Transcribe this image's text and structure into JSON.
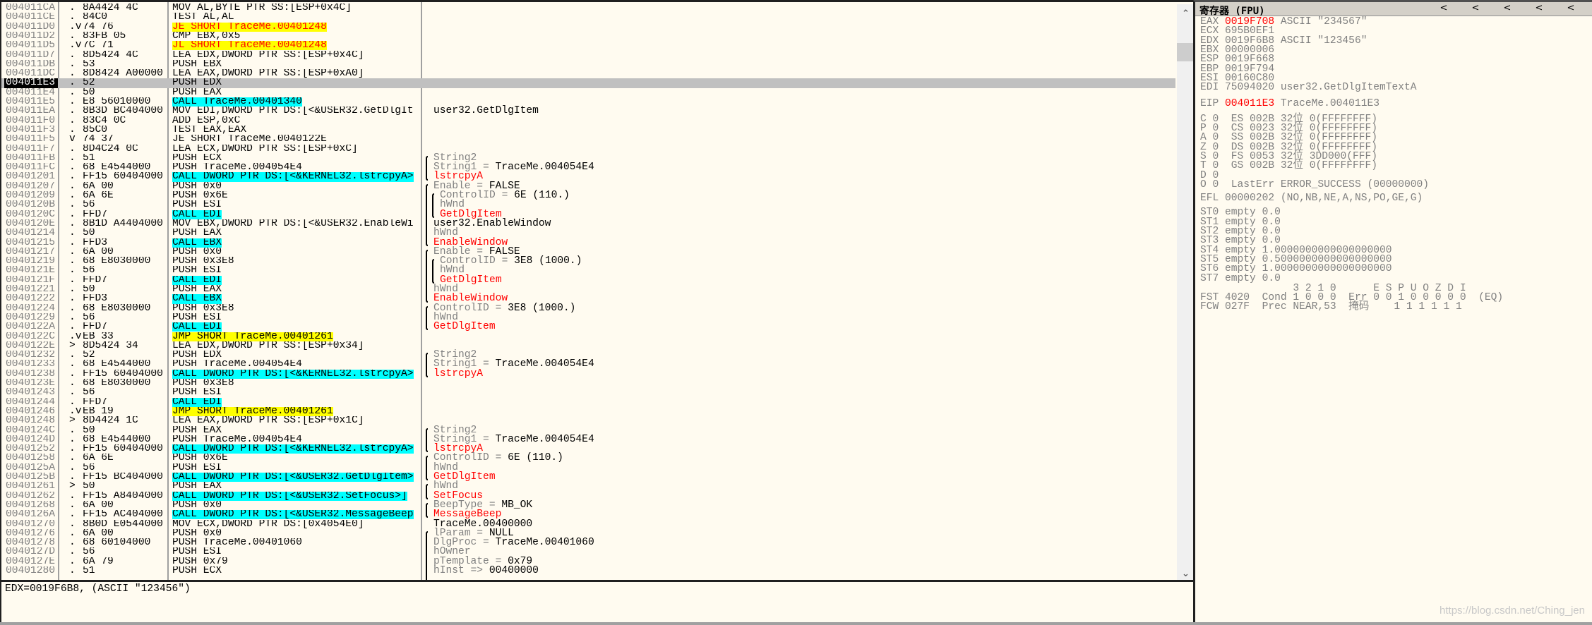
{
  "colors": {
    "background": "#fffbf0",
    "call_highlight": "#00ffff",
    "jump_highlight": "#ffff00",
    "jcc_text": "#ff0000",
    "selected_row": "#c0c0c0",
    "changed_register": "#ff0000"
  },
  "disasm": {
    "selected_index": 8,
    "rows": [
      {
        "addr": "004011CA",
        "mark": ".",
        "hex": "8A4424 4C",
        "asm": "MOV AL,BYTE PTR SS:[ESP+0x4C]",
        "hl": "",
        "cm": []
      },
      {
        "addr": "004011CE",
        "mark": ".",
        "hex": "84C0",
        "asm": "TEST AL,AL",
        "hl": "",
        "cm": []
      },
      {
        "addr": "004011D0",
        "mark": ".v",
        "hex": "74 76",
        "asm": "JE SHORT TraceMe.00401248",
        "hl": "jcc",
        "cm": []
      },
      {
        "addr": "004011D2",
        "mark": ".",
        "hex": "83FB 05",
        "asm": "CMP EBX,0x5",
        "hl": "",
        "cm": []
      },
      {
        "addr": "004011D5",
        "mark": ".v",
        "hex": "7C 71",
        "asm": "JL SHORT TraceMe.00401248",
        "hl": "jcc",
        "cm": []
      },
      {
        "addr": "004011D7",
        "mark": ".",
        "hex": "8D5424 4C",
        "asm": "LEA EDX,DWORD PTR SS:[ESP+0x4C]",
        "hl": "",
        "cm": []
      },
      {
        "addr": "004011DB",
        "mark": ".",
        "hex": "53",
        "asm": "PUSH EBX",
        "hl": "",
        "cm": []
      },
      {
        "addr": "004011DC",
        "mark": ".",
        "hex": "8D8424 A00000",
        "asm": "LEA EAX,DWORD PTR SS:[ESP+0xA0]",
        "hl": "",
        "cm": []
      },
      {
        "addr": "004011E3",
        "mark": ".",
        "hex": "52",
        "asm": "PUSH EDX",
        "hl": "",
        "cm": []
      },
      {
        "addr": "004011E4",
        "mark": ".",
        "hex": "50",
        "asm": "PUSH EAX",
        "hl": "",
        "cm": []
      },
      {
        "addr": "004011E5",
        "mark": ".",
        "hex": "E8 56010000",
        "asm": "CALL TraceMe.00401340",
        "hl": "call",
        "cm": []
      },
      {
        "addr": "004011EA",
        "mark": ".",
        "hex": "8B3D BC404000",
        "asm": "MOV EDI,DWORD PTR DS:[<&USER32.GetDlgIt",
        "hl": "",
        "cm": [
          [
            "user32.GetDlgItem",
            "k"
          ]
        ]
      },
      {
        "addr": "004011F0",
        "mark": ".",
        "hex": "83C4 0C",
        "asm": "ADD ESP,0xC",
        "hl": "",
        "cm": []
      },
      {
        "addr": "004011F3",
        "mark": ".",
        "hex": "85C0",
        "asm": "TEST EAX,EAX",
        "hl": "",
        "cm": []
      },
      {
        "addr": "004011F5",
        "mark": "v",
        "hex": "74 37",
        "asm": "JE SHORT TraceMe.0040122E",
        "hl": "",
        "cm": []
      },
      {
        "addr": "004011F7",
        "mark": ".",
        "hex": "8D4C24 0C",
        "asm": "LEA ECX,DWORD PTR SS:[ESP+0xC]",
        "hl": "",
        "cm": []
      },
      {
        "addr": "004011FB",
        "mark": ".",
        "hex": "51",
        "asm": "PUSH ECX",
        "hl": "",
        "cm": [
          [
            "String2",
            "g"
          ]
        ]
      },
      {
        "addr": "004011FC",
        "mark": ".",
        "hex": "68 E4544000",
        "asm": "PUSH TraceMe.004054E4",
        "hl": "",
        "cm": [
          [
            "String1 = ",
            "g"
          ],
          [
            "TraceMe.004054E4",
            "k"
          ]
        ]
      },
      {
        "addr": "00401201",
        "mark": ".",
        "hex": "FF15 60404000",
        "asm": "CALL DWORD PTR DS:[<&KERNEL32.lstrcpyA>",
        "hl": "call",
        "cm": [
          [
            "lstrcpyA",
            "r"
          ]
        ]
      },
      {
        "addr": "00401207",
        "mark": ".",
        "hex": "6A 00",
        "asm": "PUSH 0x0",
        "hl": "",
        "cm": [
          [
            "Enable = ",
            "g"
          ],
          [
            "FALSE",
            "k"
          ]
        ]
      },
      {
        "addr": "00401209",
        "mark": ".",
        "hex": "6A 6E",
        "asm": "PUSH 0x6E",
        "hl": "",
        "cm": [
          [
            "ControlID = ",
            "g"
          ],
          [
            "6E (110.)",
            "k"
          ]
        ]
      },
      {
        "addr": "0040120B",
        "mark": ".",
        "hex": "56",
        "asm": "PUSH ESI",
        "hl": "",
        "cm": [
          [
            "hWnd",
            "g"
          ]
        ]
      },
      {
        "addr": "0040120C",
        "mark": ".",
        "hex": "FFD7",
        "asm": "CALL EDI",
        "hl": "call",
        "cm": [
          [
            "GetDlgItem",
            "r"
          ]
        ]
      },
      {
        "addr": "0040120E",
        "mark": ".",
        "hex": "8B1D A4404000",
        "asm": "MOV EBX,DWORD PTR DS:[<&USER32.EnableWi",
        "hl": "",
        "cm": [
          [
            "user32.EnableWindow",
            "k"
          ]
        ]
      },
      {
        "addr": "00401214",
        "mark": ".",
        "hex": "50",
        "asm": "PUSH EAX",
        "hl": "",
        "cm": [
          [
            "hWnd",
            "g"
          ]
        ]
      },
      {
        "addr": "00401215",
        "mark": ".",
        "hex": "FFD3",
        "asm": "CALL EBX",
        "hl": "call",
        "cm": [
          [
            "EnableWindow",
            "r"
          ]
        ]
      },
      {
        "addr": "00401217",
        "mark": ".",
        "hex": "6A 00",
        "asm": "PUSH 0x0",
        "hl": "",
        "cm": [
          [
            "Enable = ",
            "g"
          ],
          [
            "FALSE",
            "k"
          ]
        ]
      },
      {
        "addr": "00401219",
        "mark": ".",
        "hex": "68 E8030000",
        "asm": "PUSH 0x3E8",
        "hl": "",
        "cm": [
          [
            "ControlID = ",
            "g"
          ],
          [
            "3E8 (1000.)",
            "k"
          ]
        ]
      },
      {
        "addr": "0040121E",
        "mark": ".",
        "hex": "56",
        "asm": "PUSH ESI",
        "hl": "",
        "cm": [
          [
            "hWnd",
            "g"
          ]
        ]
      },
      {
        "addr": "0040121F",
        "mark": ".",
        "hex": "FFD7",
        "asm": "CALL EDI",
        "hl": "call",
        "cm": [
          [
            "GetDlgItem",
            "r"
          ]
        ]
      },
      {
        "addr": "00401221",
        "mark": ".",
        "hex": "50",
        "asm": "PUSH EAX",
        "hl": "",
        "cm": [
          [
            "hWnd",
            "g"
          ]
        ]
      },
      {
        "addr": "00401222",
        "mark": ".",
        "hex": "FFD3",
        "asm": "CALL EBX",
        "hl": "call",
        "cm": [
          [
            "EnableWindow",
            "r"
          ]
        ]
      },
      {
        "addr": "00401224",
        "mark": ".",
        "hex": "68 E8030000",
        "asm": "PUSH 0x3E8",
        "hl": "",
        "cm": [
          [
            "ControlID = ",
            "g"
          ],
          [
            "3E8 (1000.)",
            "k"
          ]
        ]
      },
      {
        "addr": "00401229",
        "mark": ".",
        "hex": "56",
        "asm": "PUSH ESI",
        "hl": "",
        "cm": [
          [
            "hWnd",
            "g"
          ]
        ]
      },
      {
        "addr": "0040122A",
        "mark": ".",
        "hex": "FFD7",
        "asm": "CALL EDI",
        "hl": "call",
        "cm": [
          [
            "GetDlgItem",
            "r"
          ]
        ]
      },
      {
        "addr": "0040122C",
        "mark": ".v",
        "hex": "EB 33",
        "asm": "JMP SHORT TraceMe.00401261",
        "hl": "jmp",
        "cm": []
      },
      {
        "addr": "0040122E",
        "mark": ">",
        "hex": "8D5424 34",
        "asm": "LEA EDX,DWORD PTR SS:[ESP+0x34]",
        "hl": "",
        "cm": []
      },
      {
        "addr": "00401232",
        "mark": ".",
        "hex": "52",
        "asm": "PUSH EDX",
        "hl": "",
        "cm": [
          [
            "String2",
            "g"
          ]
        ]
      },
      {
        "addr": "00401233",
        "mark": ".",
        "hex": "68 E4544000",
        "asm": "PUSH TraceMe.004054E4",
        "hl": "",
        "cm": [
          [
            "String1 = ",
            "g"
          ],
          [
            "TraceMe.004054E4",
            "k"
          ]
        ]
      },
      {
        "addr": "00401238",
        "mark": ".",
        "hex": "FF15 60404000",
        "asm": "CALL DWORD PTR DS:[<&KERNEL32.lstrcpyA>",
        "hl": "call",
        "cm": [
          [
            "lstrcpyA",
            "r"
          ]
        ]
      },
      {
        "addr": "0040123E",
        "mark": ".",
        "hex": "68 E8030000",
        "asm": "PUSH 0x3E8",
        "hl": "",
        "cm": []
      },
      {
        "addr": "00401243",
        "mark": ".",
        "hex": "56",
        "asm": "PUSH ESI",
        "hl": "",
        "cm": []
      },
      {
        "addr": "00401244",
        "mark": ".",
        "hex": "FFD7",
        "asm": "CALL EDI",
        "hl": "call",
        "cm": []
      },
      {
        "addr": "00401246",
        "mark": ".v",
        "hex": "EB 19",
        "asm": "JMP SHORT TraceMe.00401261",
        "hl": "jmp",
        "cm": []
      },
      {
        "addr": "00401248",
        "mark": ">",
        "hex": "8D4424 1C",
        "asm": "LEA EAX,DWORD PTR SS:[ESP+0x1C]",
        "hl": "",
        "cm": []
      },
      {
        "addr": "0040124C",
        "mark": ".",
        "hex": "50",
        "asm": "PUSH EAX",
        "hl": "",
        "cm": [
          [
            "String2",
            "g"
          ]
        ]
      },
      {
        "addr": "0040124D",
        "mark": ".",
        "hex": "68 E4544000",
        "asm": "PUSH TraceMe.004054E4",
        "hl": "",
        "cm": [
          [
            "String1 = ",
            "g"
          ],
          [
            "TraceMe.004054E4",
            "k"
          ]
        ]
      },
      {
        "addr": "00401252",
        "mark": ".",
        "hex": "FF15 60404000",
        "asm": "CALL DWORD PTR DS:[<&KERNEL32.lstrcpyA>",
        "hl": "call",
        "cm": [
          [
            "lstrcpyA",
            "r"
          ]
        ]
      },
      {
        "addr": "00401258",
        "mark": ".",
        "hex": "6A 6E",
        "asm": "PUSH 0x6E",
        "hl": "",
        "cm": [
          [
            "ControlID = ",
            "g"
          ],
          [
            "6E (110.)",
            "k"
          ]
        ]
      },
      {
        "addr": "0040125A",
        "mark": ".",
        "hex": "56",
        "asm": "PUSH ESI",
        "hl": "",
        "cm": [
          [
            "hWnd",
            "g"
          ]
        ]
      },
      {
        "addr": "0040125B",
        "mark": ".",
        "hex": "FF15 BC404000",
        "asm": "CALL DWORD PTR DS:[<&USER32.GetDlgItem>",
        "hl": "call",
        "cm": [
          [
            "GetDlgItem",
            "r"
          ]
        ]
      },
      {
        "addr": "00401261",
        "mark": ">",
        "hex": "50",
        "asm": "PUSH EAX",
        "hl": "",
        "cm": [
          [
            "hWnd",
            "g"
          ]
        ]
      },
      {
        "addr": "00401262",
        "mark": ".",
        "hex": "FF15 A8404000",
        "asm": "CALL DWORD PTR DS:[<&USER32.SetFocus>]",
        "hl": "call",
        "cm": [
          [
            "SetFocus",
            "r"
          ]
        ]
      },
      {
        "addr": "00401268",
        "mark": ".",
        "hex": "6A 00",
        "asm": "PUSH 0x0",
        "hl": "",
        "cm": [
          [
            "BeepType = ",
            "g"
          ],
          [
            "MB_OK",
            "k"
          ]
        ]
      },
      {
        "addr": "0040126A",
        "mark": ".",
        "hex": "FF15 AC404000",
        "asm": "CALL DWORD PTR DS:[<&USER32.MessageBeep",
        "hl": "call",
        "cm": [
          [
            "MessageBeep",
            "r"
          ]
        ]
      },
      {
        "addr": "00401270",
        "mark": ".",
        "hex": "8B0D E0544000",
        "asm": "MOV ECX,DWORD PTR DS:[0x4054E0]",
        "hl": "",
        "cm": [
          [
            "TraceMe.00400000",
            "k"
          ]
        ]
      },
      {
        "addr": "00401276",
        "mark": ".",
        "hex": "6A 00",
        "asm": "PUSH 0x0",
        "hl": "",
        "cm": [
          [
            "lParam = ",
            "g"
          ],
          [
            "NULL",
            "k"
          ]
        ]
      },
      {
        "addr": "00401278",
        "mark": ".",
        "hex": "68 60104000",
        "asm": "PUSH TraceMe.00401060",
        "hl": "",
        "cm": [
          [
            "DlgProc = ",
            "g"
          ],
          [
            "TraceMe.00401060",
            "k"
          ]
        ]
      },
      {
        "addr": "0040127D",
        "mark": ".",
        "hex": "56",
        "asm": "PUSH ESI",
        "hl": "",
        "cm": [
          [
            "hOwner",
            "g"
          ]
        ]
      },
      {
        "addr": "0040127E",
        "mark": ".",
        "hex": "6A 79",
        "asm": "PUSH 0x79",
        "hl": "",
        "cm": [
          [
            "pTemplate = ",
            "g"
          ],
          [
            "0x79",
            "k"
          ]
        ]
      },
      {
        "addr": "00401280",
        "mark": ".",
        "hex": "51",
        "asm": "PUSH ECX",
        "hl": "",
        "cm": [
          [
            "hInst => ",
            "g"
          ],
          [
            "00400000",
            "k"
          ]
        ]
      }
    ]
  },
  "info": {
    "text": "EDX=0019F6B8, (ASCII \"123456\")"
  },
  "registers": {
    "title": "寄存器 (FPU)",
    "nav_buttons": [
      "<",
      "<",
      "<",
      "<",
      "<"
    ],
    "lines": [
      [
        [
          "EAX ",
          "g"
        ],
        [
          "0019F708",
          "r"
        ],
        [
          " ASCII \"234567\"",
          "g"
        ]
      ],
      [
        [
          "ECX 695B0EF1",
          "g"
        ]
      ],
      [
        [
          "EDX 0019F6B8 ASCII \"123456\"",
          "g"
        ]
      ],
      [
        [
          "EBX 00000006",
          "g"
        ]
      ],
      [
        [
          "ESP 0019F668",
          "g"
        ]
      ],
      [
        [
          "EBP 0019F794",
          "g"
        ]
      ],
      [
        [
          "ESI 00160C80",
          "g"
        ]
      ],
      [
        [
          "EDI 75094020 user32.GetDlgItemTextA",
          "g"
        ]
      ],
      [
        [
          "EIP ",
          "g"
        ],
        [
          "004011E3",
          "r"
        ],
        [
          " TraceMe.004011E3",
          "g"
        ]
      ],
      [
        [
          "C 0  ES 002B 32位 0(FFFFFFFF)",
          "g"
        ]
      ],
      [
        [
          "P 0  CS 0023 32位 0(FFFFFFFF)",
          "g"
        ]
      ],
      [
        [
          "A 0  SS 002B 32位 0(FFFFFFFF)",
          "g"
        ]
      ],
      [
        [
          "Z 0  DS 002B 32位 0(FFFFFFFF)",
          "g"
        ]
      ],
      [
        [
          "S 0  FS 0053 32位 3DD000(FFF)",
          "g"
        ]
      ],
      [
        [
          "T 0  GS 002B 32位 0(FFFFFFFF)",
          "g"
        ]
      ],
      [
        [
          "D 0",
          "g"
        ]
      ],
      [
        [
          "O 0  LastErr ERROR_SUCCESS (00000000)",
          "g"
        ]
      ],
      [
        [
          "EFL 00000202 (NO,NB,NE,A,NS,PO,GE,G)",
          "g"
        ]
      ],
      [
        [
          "ST0 empty 0.0",
          "g"
        ]
      ],
      [
        [
          "ST1 empty 0.0",
          "g"
        ]
      ],
      [
        [
          "ST2 empty 0.0",
          "g"
        ]
      ],
      [
        [
          "ST3 empty 0.0",
          "g"
        ]
      ],
      [
        [
          "ST4 empty 1.0000000000000000000",
          "g"
        ]
      ],
      [
        [
          "ST5 empty 0.5000000000000000000",
          "g"
        ]
      ],
      [
        [
          "ST6 empty 1.0000000000000000000",
          "g"
        ]
      ],
      [
        [
          "ST7 empty 0.0",
          "g"
        ]
      ],
      [
        [
          "               3 2 1 0      E S P U O Z D I",
          "g"
        ]
      ],
      [
        [
          "FST 4020  Cond 1 0 0 0  Err 0 0 1 0 0 0 0 0  (EQ)",
          "g"
        ]
      ],
      [
        [
          "FCW 027F  Prec NEAR,53  掩码    1 1 1 1 1 1",
          "g"
        ]
      ]
    ]
  },
  "watermark": "https://blog.csdn.net/Ching_jen"
}
